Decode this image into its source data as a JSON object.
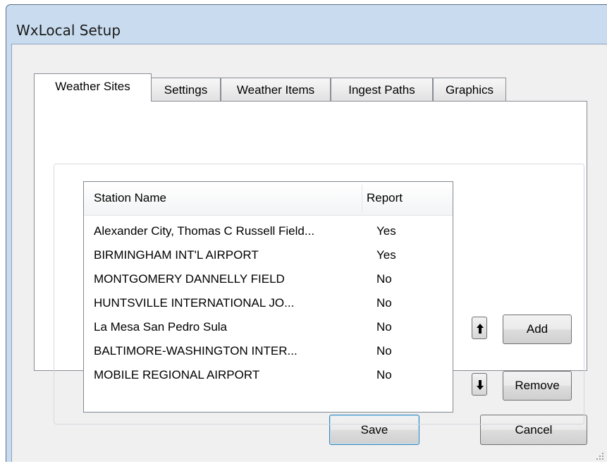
{
  "window": {
    "title": "WxLocal Setup"
  },
  "tabs": [
    {
      "label": "Weather Sites",
      "active": true
    },
    {
      "label": "Settings",
      "active": false
    },
    {
      "label": "Weather Items",
      "active": false
    },
    {
      "label": "Ingest Paths",
      "active": false
    },
    {
      "label": "Graphics",
      "active": false
    }
  ],
  "stations": {
    "columns": {
      "name": "Station Name",
      "report": "Report"
    },
    "rows": [
      {
        "name": "Alexander City, Thomas C Russell Field...",
        "report": "Yes"
      },
      {
        "name": "BIRMINGHAM INT'L AIRPORT",
        "report": "Yes"
      },
      {
        "name": "MONTGOMERY DANNELLY FIELD",
        "report": "No"
      },
      {
        "name": "HUNTSVILLE INTERNATIONAL  JO...",
        "report": "No"
      },
      {
        "name": "La Mesa San Pedro Sula",
        "report": "No"
      },
      {
        "name": "BALTIMORE-WASHINGTON INTER...",
        "report": "No"
      },
      {
        "name": "MOBILE REGIONAL AIRPORT",
        "report": "No"
      }
    ]
  },
  "buttons": {
    "add": "Add",
    "remove": "Remove",
    "save": "Save",
    "cancel": "Cancel"
  },
  "icons": {
    "move_up": "arrow-up-icon",
    "move_down": "arrow-down-icon",
    "grip": "resize-grip-icon"
  }
}
